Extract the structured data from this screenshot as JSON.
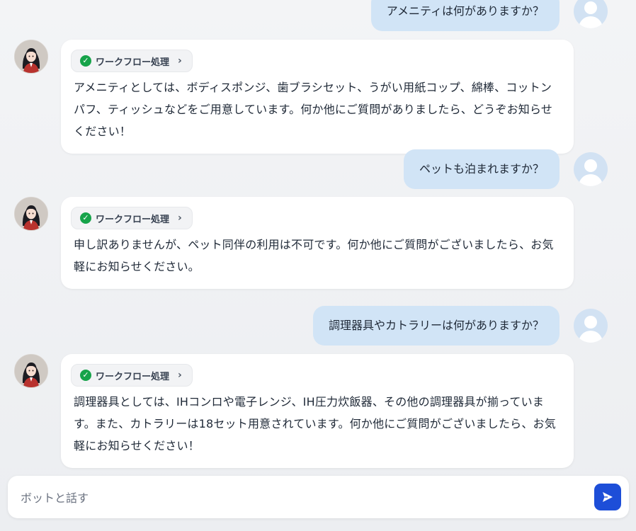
{
  "messages": [
    {
      "role": "user",
      "text": "アメニティは何がありますか？"
    },
    {
      "role": "bot",
      "workflow_label": "ワークフロー処理",
      "text": "アメニティとしては、ボディスポンジ、歯ブラシセット、うがい用紙コップ、綿棒、コットンパフ、ティッシュなどをご用意しています。何か他にご質問がありましたら、どうぞお知らせください！"
    },
    {
      "role": "user",
      "text": "ペットも泊まれますか？"
    },
    {
      "role": "bot",
      "workflow_label": "ワークフロー処理",
      "text": "申し訳ありませんが、ペット同伴の利用は不可です。何か他にご質問がございましたら、お気軽にお知らせください。"
    },
    {
      "role": "user",
      "text": "調理器具やカトラリーは何がありますか？"
    },
    {
      "role": "bot",
      "workflow_label": "ワークフロー処理",
      "text": "調理器具としては、IHコンロや電子レンジ、IH圧力炊飯器、その他の調理器具が揃っています。また、カトラリーは18セット用意されています。何か他にご質問がございましたら、お気軽にお知らせください！"
    }
  ],
  "composer": {
    "placeholder": "ボットと話す",
    "value": ""
  },
  "icons": {
    "workflow_status": "check-circle-icon",
    "workflow_expand": "chevron-right-icon",
    "send": "send-icon",
    "user_avatar": "user-avatar-icon",
    "bot_avatar": "bot-avatar"
  },
  "colors": {
    "user_bubble": "#d1e4f6",
    "accent": "#1d4ed8",
    "success": "#16a34a"
  }
}
